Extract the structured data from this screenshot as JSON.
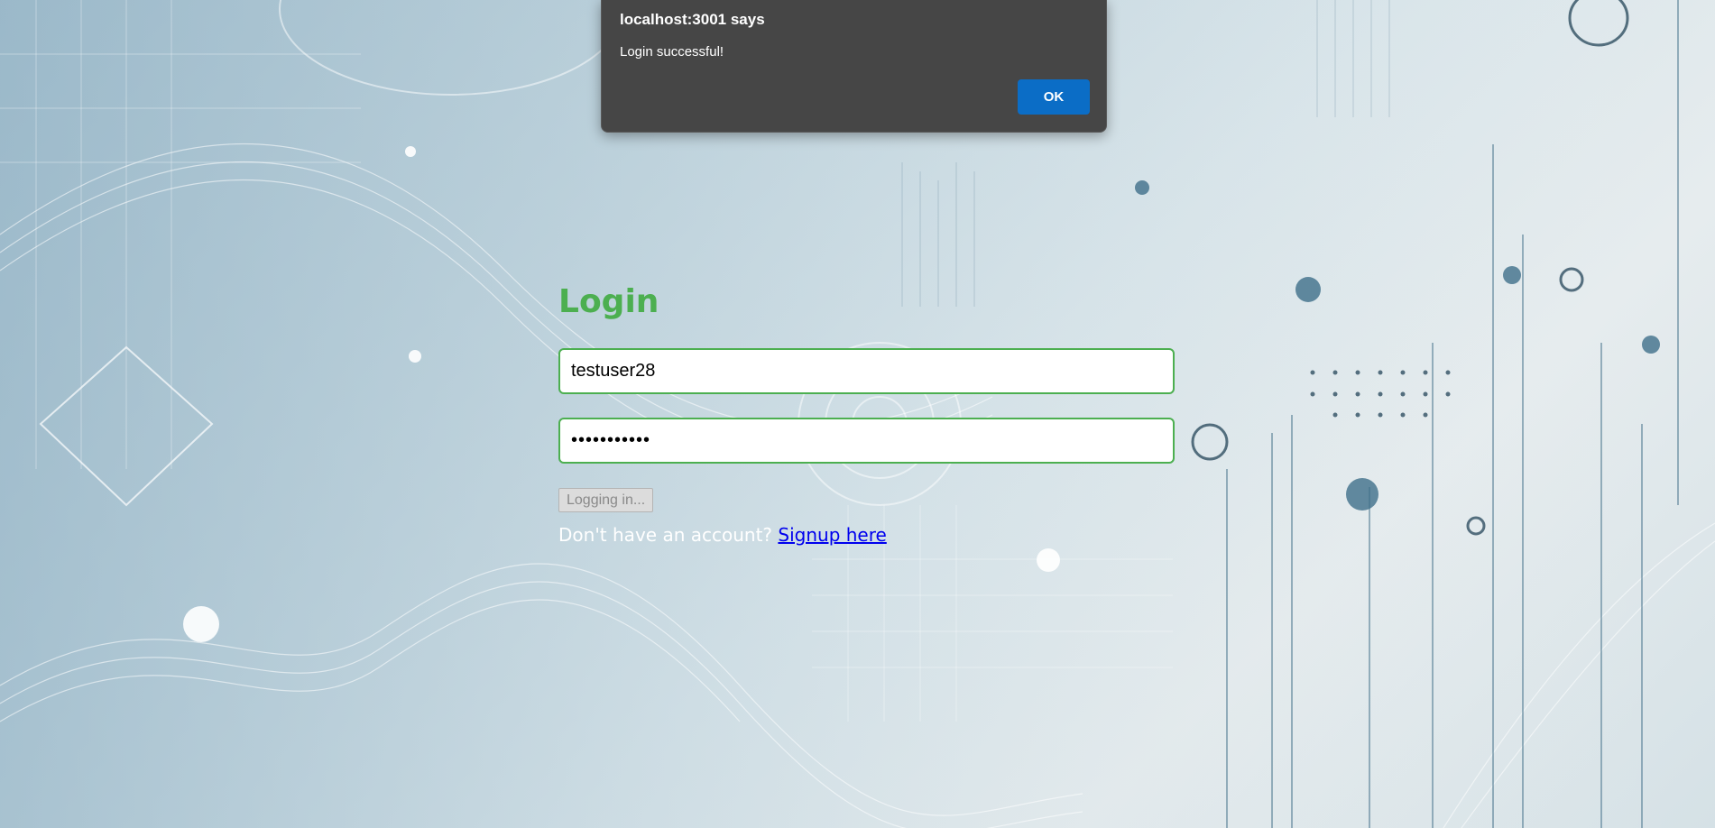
{
  "alert": {
    "title": "localhost:3001 says",
    "message": "Login successful!",
    "ok_label": "OK"
  },
  "login": {
    "title": "Login",
    "username_value": "testuser28",
    "password_value": "•••••••••••",
    "submit_label": "Logging in...",
    "signup_prompt": "Don't have an account?",
    "signup_link": "Signup here"
  },
  "colors": {
    "accent": "#4caf50",
    "link": "#0000ee",
    "dialog_bg": "#464646",
    "dialog_button": "#0b6dc6"
  }
}
